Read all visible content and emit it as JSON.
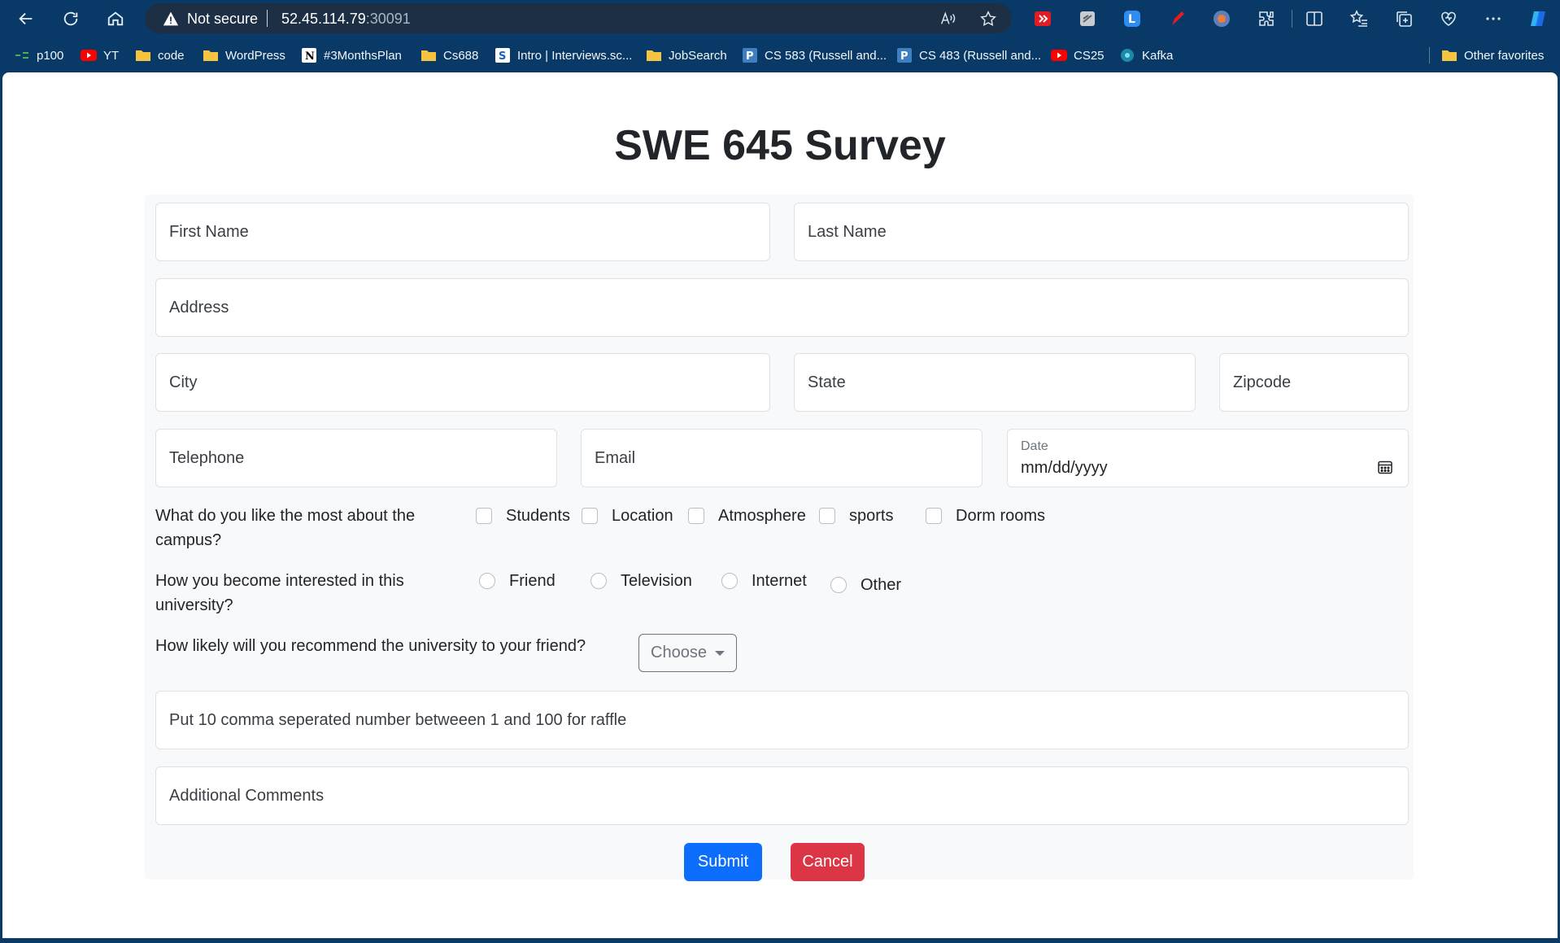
{
  "browser": {
    "not_secure": "Not secure",
    "url_host": "52.45.114.79",
    "url_port": ":30091",
    "bookmarks": [
      "p100",
      "YT",
      "code",
      "WordPress",
      "#3MonthsPlan",
      "Cs688",
      "Intro | Interviews.sc...",
      "JobSearch",
      "CS 583 (Russell and...",
      "CS 483 (Russell and...",
      "CS25",
      "Kafka"
    ],
    "other_favorites": "Other favorites"
  },
  "page": {
    "title": "SWE 645 Survey"
  },
  "form": {
    "first_name_placeholder": "First Name",
    "last_name_placeholder": "Last Name",
    "address_placeholder": "Address",
    "city_placeholder": "City",
    "state_placeholder": "State",
    "zipcode_placeholder": "Zipcode",
    "telephone_placeholder": "Telephone",
    "email_placeholder": "Email",
    "date_label": "Date",
    "date_value": "mm/dd/yyyy",
    "q_like_line1": "What do you like the most about the",
    "q_like_line2": "campus?",
    "like_options": [
      "Students",
      "Location",
      "Atmosphere",
      "sports",
      "Dorm rooms"
    ],
    "q_interest_line1": "How you become interested in this",
    "q_interest_line2": "university?",
    "interest_options": [
      "Friend",
      "Television",
      "Internet",
      "Other"
    ],
    "q_recommend": "How likely will you recommend the university to your friend?",
    "choose_label": "Choose",
    "raffle_placeholder": "Put 10 comma seperated number betweeen 1 and 100 for raffle",
    "comments_placeholder": "Additional Comments",
    "submit_label": "Submit",
    "cancel_label": "Cancel"
  },
  "colors": {
    "chrome_bg": "#093a67",
    "primary": "#0d6efd",
    "danger": "#dc3545",
    "form_bg": "#f8f9fa"
  }
}
